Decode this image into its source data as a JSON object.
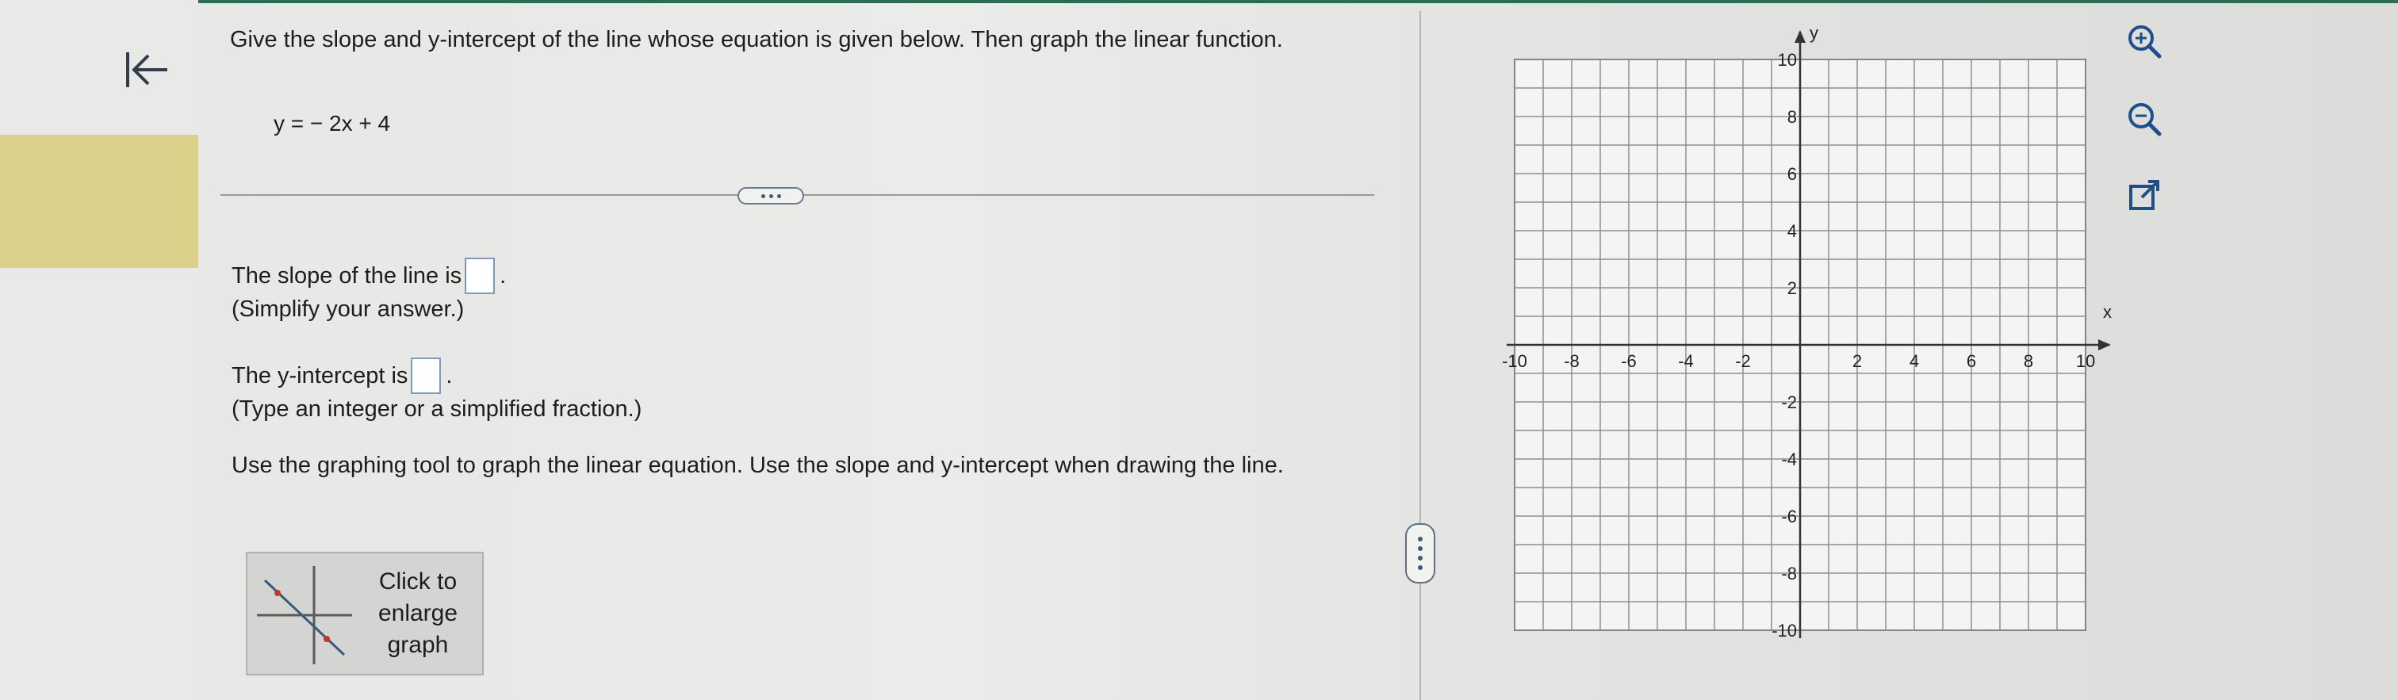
{
  "question": {
    "text": "Give the slope and y-intercept of the line whose equation is given below. Then graph the linear function.",
    "equation": "y = − 2x + 4"
  },
  "answers": {
    "slope_prefix": "The slope of the line is",
    "slope_value": "",
    "slope_hint": "(Simplify your answer.)",
    "intercept_prefix": "The y-intercept is",
    "intercept_value": "",
    "intercept_hint": "(Type an integer or a simplified fraction.)",
    "graph_instruction": "Use the graphing tool to graph the linear equation. Use the slope and y-intercept when drawing the line."
  },
  "enlarge_button": {
    "label": "Click to enlarge graph"
  },
  "graph": {
    "x_axis_label": "x",
    "y_axis_label": "y",
    "x_range": [
      -10,
      10
    ],
    "y_range": [
      -10,
      10
    ],
    "x_tick_labels": [
      "-10",
      "-8",
      "-6",
      "-4",
      "-2",
      "2",
      "4",
      "6",
      "8",
      "10"
    ],
    "y_tick_labels": [
      "10",
      "8",
      "6",
      "4",
      "2",
      "-2",
      "-4",
      "-6",
      "-8",
      "-10"
    ]
  },
  "toolbar": {
    "icons": [
      "zoom-in-icon",
      "zoom-out-icon",
      "popout-icon"
    ]
  },
  "colors": {
    "accent": "#2e6b56",
    "highlight": "#dbd08a",
    "link": "#3b5a7a"
  }
}
